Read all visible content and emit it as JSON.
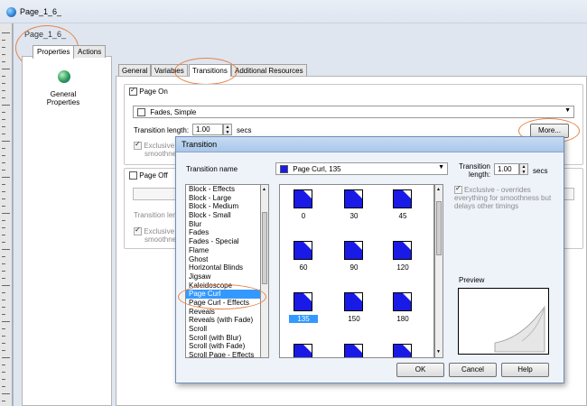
{
  "window": {
    "title": "Page_1_6_"
  },
  "page_label": "Page_1_6_",
  "left_tabs": [
    {
      "label": "Properties"
    },
    {
      "label": "Actions"
    }
  ],
  "left_panel": {
    "item_label": "General Properties"
  },
  "right_tabs": [
    {
      "label": "General"
    },
    {
      "label": "Variables"
    },
    {
      "label": "Transitions"
    },
    {
      "label": "Additional Resources"
    }
  ],
  "page_on": {
    "checkbox_label": "Page On",
    "transition_value": "Fades, Simple",
    "length_label": "Transition length:",
    "length_value": "1.00",
    "length_unit": "secs",
    "more_label": "More...",
    "exclusive_partial": "Exclusive",
    "exclusive_partial2": "smoothne"
  },
  "page_off": {
    "checkbox_label": "Page Off",
    "length_partial": "Transition len",
    "exclusive_partial": "Exclusive",
    "exclusive_partial2": "smoothne"
  },
  "dialog": {
    "title": "Transition",
    "name_label": "Transition name",
    "name_value": "Page Curl, 135",
    "length_label1": "Transition",
    "length_label2": "length:",
    "length_value": "1.00",
    "length_unit": "secs",
    "exclusive_text": "Exclusive - overrides everything for smoothness but delays other timings",
    "preview_label": "Preview",
    "list_items": [
      "Block - Effects",
      "Block - Large",
      "Block - Medium",
      "Block - Small",
      "Blur",
      "Fades",
      "Fades - Special",
      "Flame",
      "Ghost",
      "Horizontal Blinds",
      "Jigsaw",
      "Kaleidoscope",
      "Page Curl",
      "Page Curl - Effects",
      "Reveals",
      "Reveals (with Fade)",
      "Scroll",
      "Scroll (with Blur)",
      "Scroll (with Fade)",
      "Scroll Page - Effects"
    ],
    "selected_item": "Page Curl",
    "angles": [
      "0",
      "30",
      "45",
      "60",
      "90",
      "120",
      "135",
      "150",
      "180"
    ],
    "selected_angle": "135",
    "ok_label": "OK",
    "cancel_label": "Cancel",
    "help_label": "Help"
  },
  "colors": {
    "selection": "#3399ff",
    "thumb_blue": "#1a1ae6",
    "annotation": "#e8844a"
  }
}
